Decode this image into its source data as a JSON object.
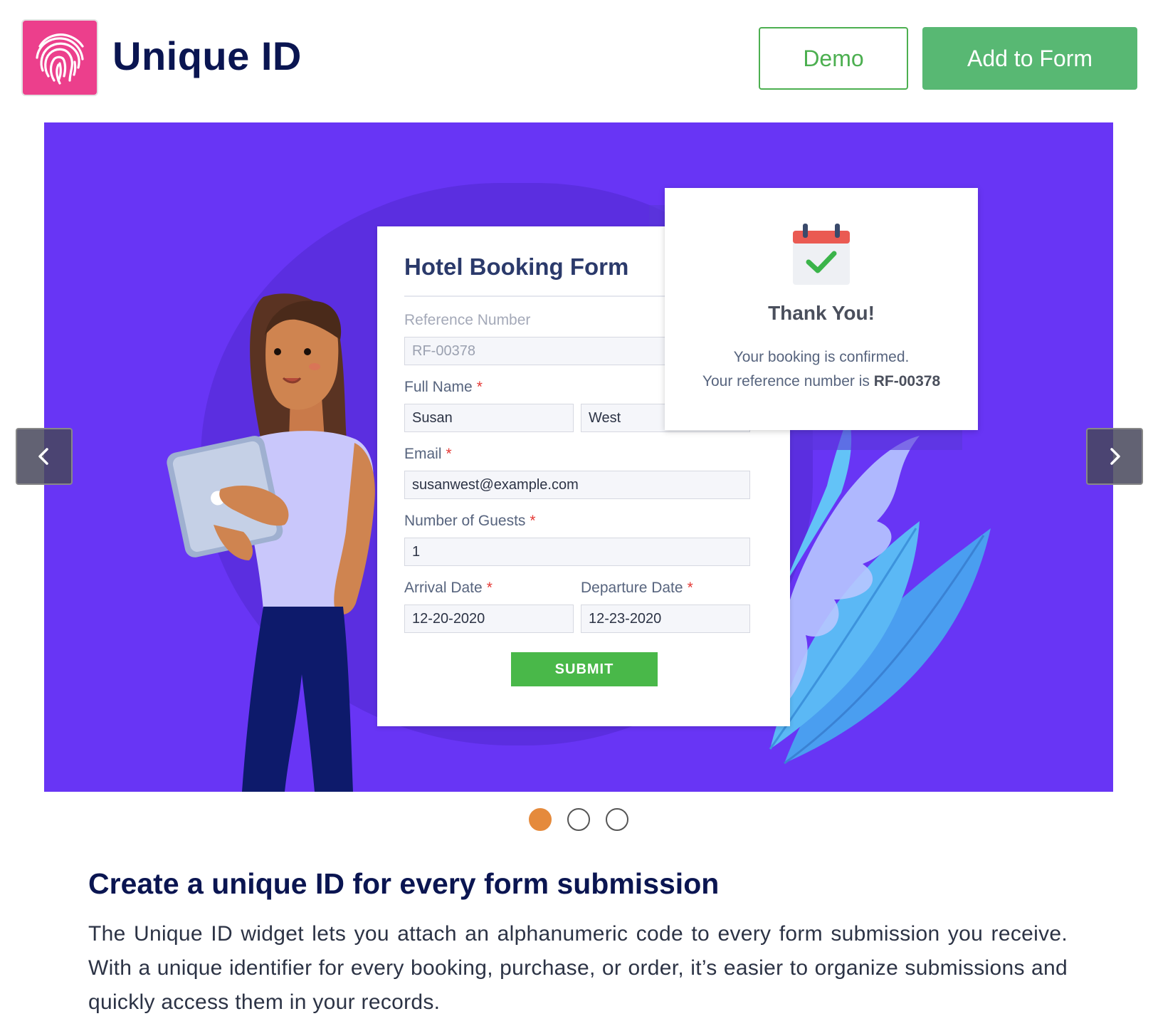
{
  "header": {
    "title": "Unique ID",
    "logo_icon": "fingerprint-icon",
    "demo_label": "Demo",
    "add_label": "Add to Form"
  },
  "colors": {
    "logo_bg": "#ec3f8c",
    "primary_green": "#58b873",
    "carousel_bg": "#6835f5",
    "active_dot": "#e58a3c",
    "title_navy": "#0a1551"
  },
  "carousel": {
    "prev_icon": "chevron-left-icon",
    "next_icon": "chevron-right-icon",
    "slide": {
      "form": {
        "title": "Hotel Booking Form",
        "reference_label": "Reference Number",
        "reference_value": "RF-00378",
        "fullname_label": "Full Name",
        "first_name": "Susan",
        "last_name": "West",
        "email_label": "Email",
        "email_value": "susanwest@example.com",
        "guests_label": "Number of Guests",
        "guests_value": "1",
        "arrival_label": "Arrival Date",
        "arrival_value": "12-20-2020",
        "departure_label": "Departure Date",
        "departure_value": "12-23-2020",
        "required_mark": "*",
        "submit_label": "SUBMIT"
      },
      "thank_you": {
        "icon": "calendar-check-icon",
        "title": "Thank You!",
        "line1": "Your booking is confirmed.",
        "line2_prefix": "Your reference number is ",
        "line2_ref": "RF-00378"
      }
    },
    "dots": {
      "count": 3,
      "active_index": 0
    }
  },
  "description": {
    "title": "Create a unique ID for every form submission",
    "body": "The Unique ID widget lets you attach an alphanumeric code to every form submission you receive. With a unique identifier for every booking, purchase, or order, it’s easier to organize submissions and quickly access them in your records."
  }
}
